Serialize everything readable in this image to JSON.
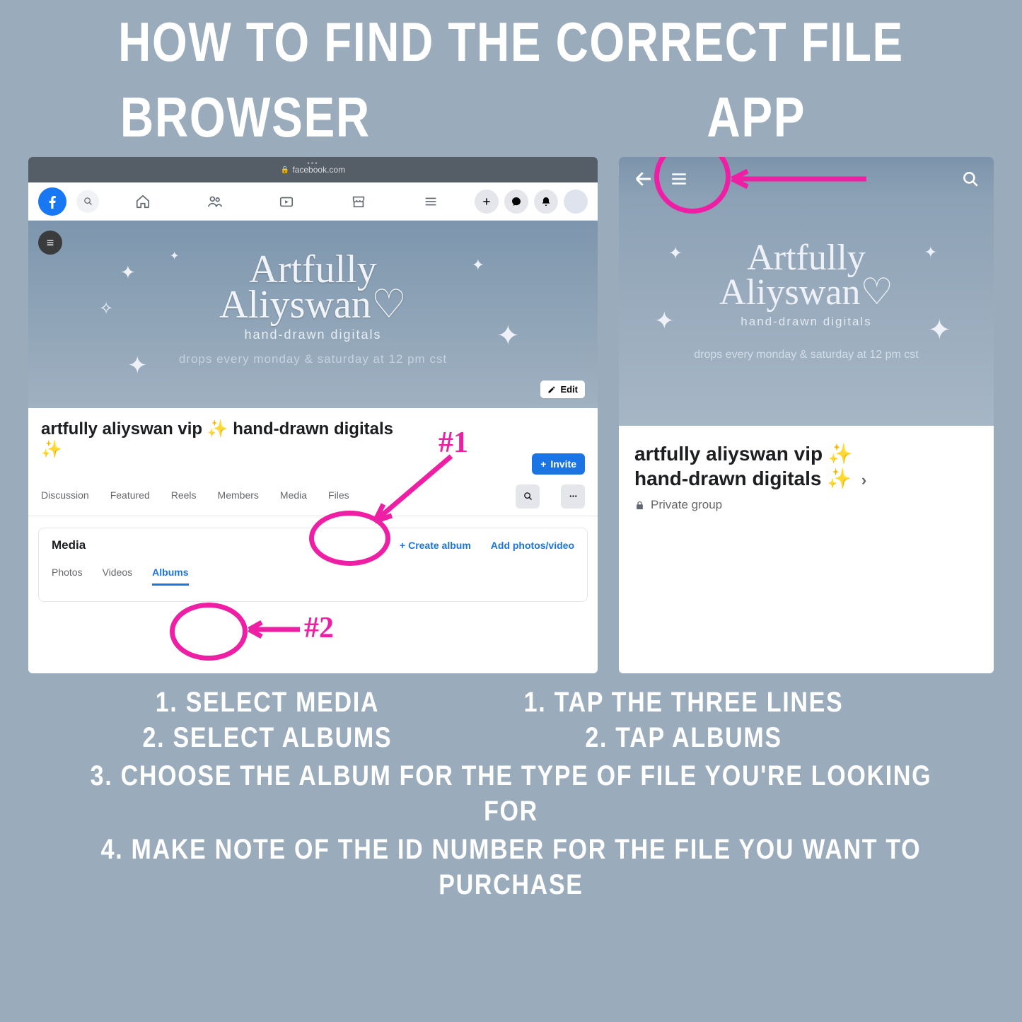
{
  "title": "HOW TO FIND THE CORRECT FILE",
  "headers": {
    "browser": "BROWSER",
    "app": "APP"
  },
  "browser": {
    "url": "facebook.com",
    "cover": {
      "script_a": "Artfully",
      "script_b": "Aliyswan♡",
      "sub1": "hand-drawn digitals",
      "sub2": "drops every monday & saturday at 12 pm cst"
    },
    "edit": "Edit",
    "group_name": "artfully aliyswan vip ✨ hand-drawn digitals ✨",
    "invite": "Invite",
    "tabs": [
      "Discussion",
      "Featured",
      "Reels",
      "Members",
      "Media",
      "Files"
    ],
    "media": {
      "title": "Media",
      "create": "Create album",
      "add": "Add photos/video",
      "subtabs": [
        "Photos",
        "Videos",
        "Albums"
      ]
    },
    "annotations": {
      "n1": "#1",
      "n2": "#2"
    }
  },
  "app": {
    "cover": {
      "script_a": "Artfully",
      "script_b": "Aliyswan♡",
      "sub1": "hand-drawn digitals",
      "sub2": "drops every monday & saturday at 12 pm cst"
    },
    "group_name_a": "artfully aliyswan vip ✨",
    "group_name_b": "hand-drawn digitals ✨",
    "privacy": "Private group"
  },
  "steps": {
    "browser": [
      "1. SELECT MEDIA",
      "2. SELECT ALBUMS"
    ],
    "app": [
      "1. TAP THE THREE LINES",
      "2. TAP ALBUMS"
    ],
    "shared": [
      "3. CHOOSE THE ALBUM FOR THE TYPE OF FILE YOU'RE LOOKING FOR",
      "4. MAKE NOTE OF THE ID NUMBER FOR THE FILE YOU WANT TO PURCHASE"
    ]
  }
}
